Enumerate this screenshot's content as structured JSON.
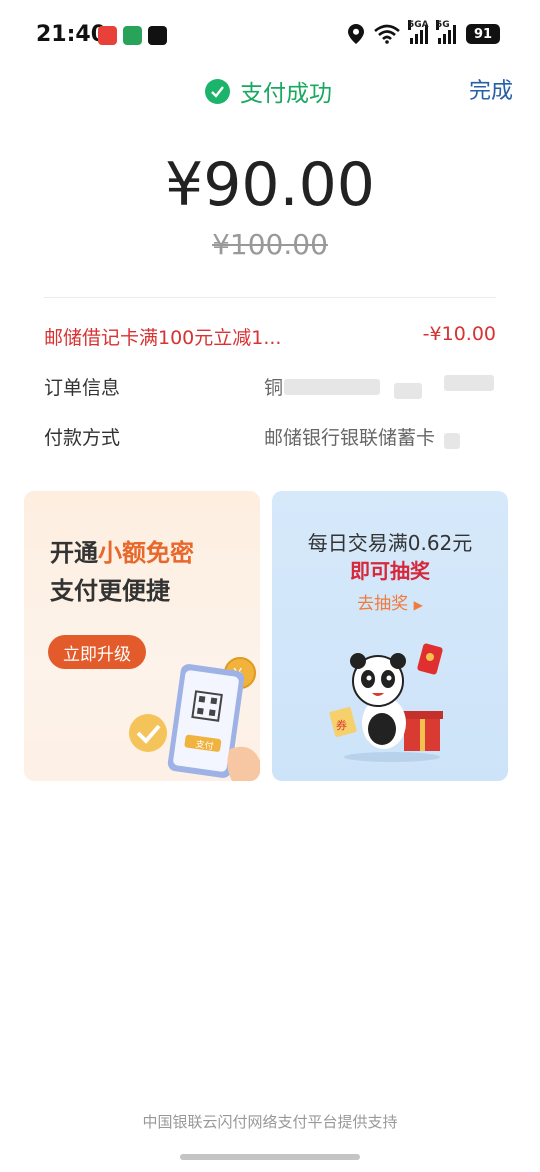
{
  "status_bar": {
    "time": "21:40",
    "network_labels": [
      "5GA",
      "5G"
    ],
    "battery": "91",
    "icons": [
      "app-notification-icon",
      "wechat-icon",
      "tiktok-icon",
      "location-icon",
      "wifi-icon"
    ]
  },
  "header": {
    "title": "支付成功",
    "done_label": "完成",
    "success_color": "#1bb46a",
    "link_color": "#2560a8"
  },
  "payment": {
    "amount": "¥90.00",
    "original_amount": "¥100.00"
  },
  "details": {
    "discount": {
      "label": "邮储借记卡满100元立减1...",
      "value": "-¥10.00"
    },
    "order": {
      "label": "订单信息",
      "value": "铜"
    },
    "payment_method": {
      "label": "付款方式",
      "value": "邮储银行银联储蓄卡"
    }
  },
  "promo_left": {
    "line1_prefix": "开通",
    "line1_highlight": "小额免密",
    "line2": "支付更便捷",
    "button_label": "立即升级",
    "phone_button_label": "支付",
    "accent_color": "#e35b2a"
  },
  "promo_right": {
    "line1": "每日交易满0.62元",
    "line2": "即可抽奖",
    "link_label": "去抽奖",
    "coupon_label": "券",
    "accent_color": "#d5283a"
  },
  "footer": {
    "text": "中国银联云闪付网络支付平台提供支持"
  }
}
